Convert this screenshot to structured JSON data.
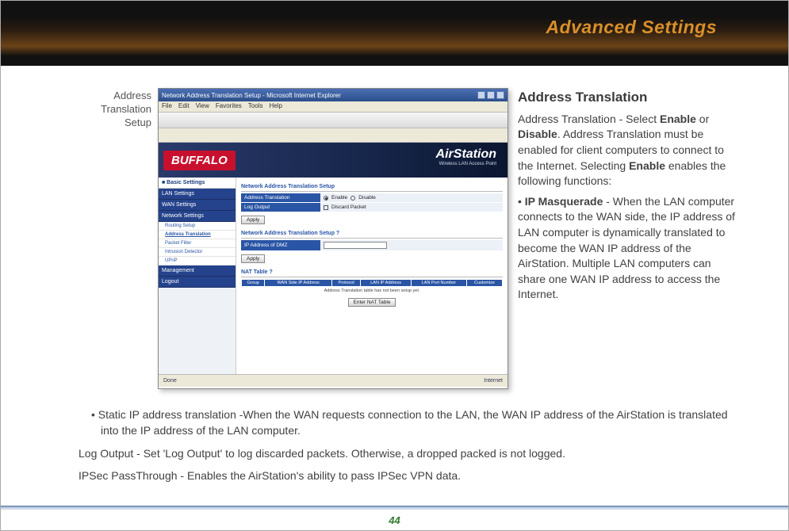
{
  "header": {
    "title": "Advanced Settings"
  },
  "side_label": {
    "l1": "Address",
    "l2": "Translation",
    "l3": "Setup"
  },
  "pagenum": "44",
  "right": {
    "heading": "Address Translation",
    "p1a": "Address Translation - Select ",
    "p1b": "Enable",
    "p1c": " or ",
    "p1d": "Disable",
    "p1e": ".  Address Translation must be enabled for client computers to connect to the Internet.  Selecting ",
    "p1f": "Enable",
    "p1g": " enables the following functions:",
    "p2a": "• ",
    "p2b": "IP Masquerade",
    "p2c": " - When the LAN computer connects to the WAN side, the IP address of LAN computer is dynamically translated to become the WAN IP address of the AirStation. Multiple LAN computers can share one WAN IP address to access the Internet."
  },
  "below": {
    "p1a": "• ",
    "p1b": "Static IP address translation",
    "p1c": " -When the WAN requests connection to the LAN, the WAN IP address of the AirStation is translated into the IP address of the LAN computer.",
    "p2a": "Log Output",
    "p2b": " - Set 'Log Output' to log discarded packets.  Otherwise, a dropped packed is not logged.",
    "p3a": "IPSec PassThrough",
    "p3b": " - Enables the AirStation's ability to pass IPSec VPN data."
  },
  "shot": {
    "title": "Network Address Translation Setup - Microsoft Internet Explorer",
    "menus": [
      "File",
      "Edit",
      "View",
      "Favorites",
      "Tools",
      "Help"
    ],
    "brand": "BUFFALO",
    "brand2": "AirStation",
    "brand_sub": "Wireless LAN Access Point",
    "nav_basic": "■ Basic Settings",
    "nav_items": [
      "LAN Settings",
      "WAN Settings",
      "Network Settings"
    ],
    "nav_subs": [
      "Routing Setup",
      "Address Translation",
      "Packet Filter",
      "Intrusion Detector",
      "UPnP"
    ],
    "nav_foot": [
      "Management",
      "Logout"
    ],
    "sec1": "Network Address Translation Setup",
    "row1_lbl": "Address Translation",
    "row1_opt1": "Enable",
    "row1_opt2": "Disable",
    "row2_lbl": "Log Output",
    "row2_opt": "Discard Packet",
    "apply": "Apply",
    "sec2": "Network Address Translation Setup  ?",
    "row3_lbl": "IP Address of DMZ",
    "sec3": "NAT Table  ?",
    "th": [
      "Group",
      "WAN Side IP Address",
      "Protocol",
      "LAN IP Address",
      "LAN Port Number",
      "Customize"
    ],
    "tbl_msg": "Address Translation table has not been setup yet.",
    "btn2": "Enter NAT Table",
    "status_l": "Done",
    "status_r": "Internet"
  }
}
